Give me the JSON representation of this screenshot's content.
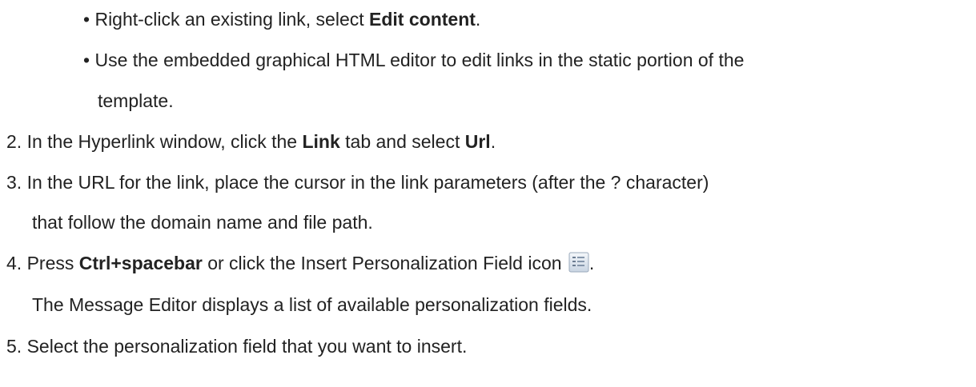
{
  "bullets": [
    {
      "marker": "•",
      "pre": "Right-click an existing link, select ",
      "bold": "Edit content",
      "post": "."
    },
    {
      "marker": "•",
      "line1": "Use the embedded graphical HTML editor to edit links in the static portion of the",
      "line2": "template."
    }
  ],
  "steps": [
    {
      "number": "2.",
      "t1": " In the Hyperlink window, click the ",
      "b1": "Link",
      "t2": " tab and select ",
      "b2": "Url",
      "t3": "."
    },
    {
      "number": "3.",
      "line1": " In the URL for the link, place the cursor in the link parameters (after the ? character)",
      "line2": "that follow the domain name and file path."
    },
    {
      "number": "4.",
      "t1": " Press ",
      "b1": "Ctrl+spacebar",
      "t2": " or click the Insert Personalization Field icon",
      "t3": ".",
      "icon": "insert-personalization-field-icon",
      "note": "The Message Editor displays a list of available personalization fields."
    },
    {
      "number": "5.",
      "text": " Select the personalization field that you want to insert."
    }
  ]
}
